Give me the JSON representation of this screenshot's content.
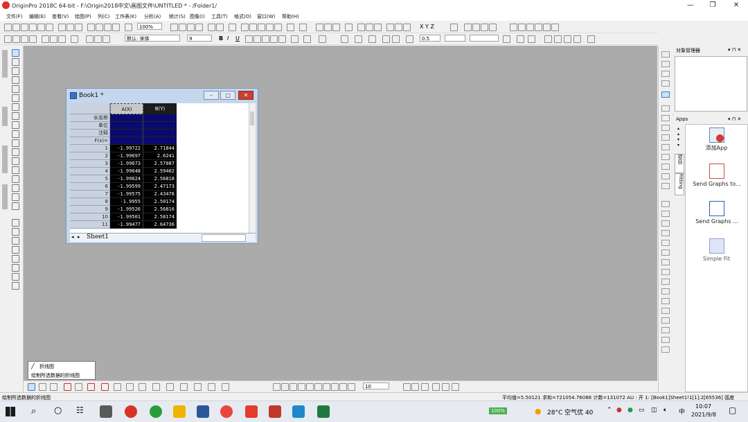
{
  "window": {
    "title": "OriginPro 2018C 64-bit - F:\\Origin2018中文\\画图文件\\UNTITLED * - /Folder1/",
    "minimize_glyph": "—",
    "maximize_glyph": "❐",
    "close_glyph": "✕"
  },
  "menu": [
    "文件(F)",
    "编辑(E)",
    "查看(V)",
    "绘图(P)",
    "列(C)",
    "工作表(K)",
    "分析(A)",
    "统计(S)",
    "图像(I)",
    "工具(T)",
    "格式(O)",
    "窗口(W)",
    "帮助(H)"
  ],
  "toolbar": {
    "zoom": "100%",
    "font": "默认: 宋体",
    "font_size": "9",
    "line_width": "0.5",
    "bold": "B",
    "italic": "I",
    "underline": "U",
    "xyz": "X Y Z"
  },
  "workbook": {
    "title": "Book1 *",
    "columns": [
      "A(X)",
      "B(Y)"
    ],
    "meta_rows": [
      "长名称",
      "单位",
      "注释",
      "F(x)="
    ],
    "rows": [
      {
        "n": "1",
        "a": "-1.99722",
        "b": "2.71844"
      },
      {
        "n": "2",
        "a": "-1.99697",
        "b": "2.6241"
      },
      {
        "n": "3",
        "a": "-1.99673",
        "b": "2.57087"
      },
      {
        "n": "4",
        "a": "-1.99648",
        "b": "2.59402"
      },
      {
        "n": "5",
        "a": "-1.99624",
        "b": "2.56818"
      },
      {
        "n": "6",
        "a": "-1.99599",
        "b": "2.47173"
      },
      {
        "n": "7",
        "a": "-1.99575",
        "b": "2.43476"
      },
      {
        "n": "8",
        "a": "-1.9955",
        "b": "2.50174"
      },
      {
        "n": "9",
        "a": "-1.99526",
        "b": "2.56816"
      },
      {
        "n": "10",
        "a": "-1.99501",
        "b": "2.58174"
      },
      {
        "n": "11",
        "a": "-1.99477",
        "b": "2.64736"
      }
    ],
    "sheet_tab": "Sheet1"
  },
  "object_manager": {
    "title": "对象管理器"
  },
  "apps_panel": {
    "title": "Apps",
    "side_tab_1": "项目",
    "side_tab_2": "Fitting",
    "items": [
      {
        "label": "添加App",
        "icon": "add-app-icon"
      },
      {
        "label": "Send Graphs to...",
        "icon": "send-pdf-icon"
      },
      {
        "label": "Send Graphs ...",
        "icon": "send-word-icon"
      },
      {
        "label": "Simple Fit",
        "icon": "simple-fit-icon"
      }
    ]
  },
  "tooltip": {
    "title": "折线图",
    "desc": "绘制所选数据的折线图"
  },
  "bottom_toolbar": {
    "size": "10"
  },
  "status": {
    "left": "绘制所选数据的折线图",
    "right": "平均值=5.50121 求和=721054.76088 计数=131072  AU : 开   1: [Book1]Sheet1!1[1]:2[65536]  弧度"
  },
  "taskbar": {
    "battery": "100%",
    "weather": "28°C 空气优 40",
    "ime": "中",
    "time": "10:07",
    "date": "2021/9/8",
    "colors": {
      "accent": "#1a73e8",
      "workspace": "#ababab",
      "column_select": "#000000"
    }
  }
}
